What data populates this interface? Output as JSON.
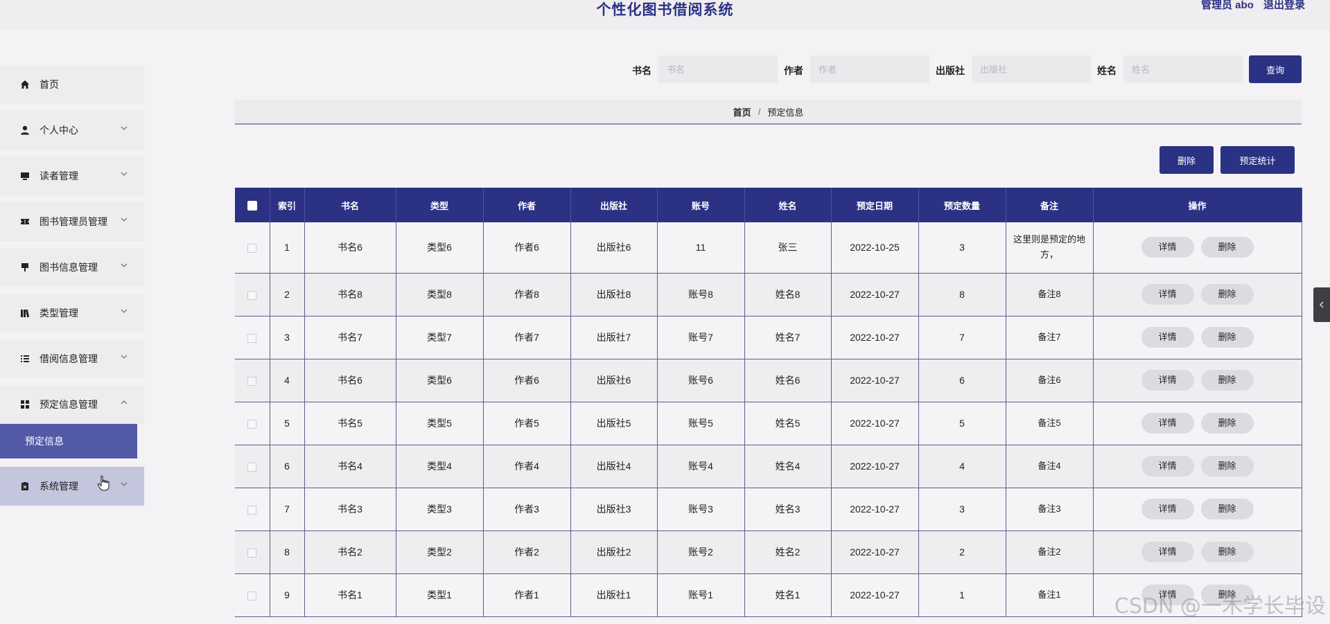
{
  "header": {
    "title": "个性化图书借阅系统",
    "user_label": "管理员 abo",
    "logout_label": "退出登录"
  },
  "sidebar": {
    "items": [
      {
        "label": "首页",
        "icon": "home-icon"
      },
      {
        "label": "个人中心",
        "icon": "user-icon"
      },
      {
        "label": "读者管理",
        "icon": "monitor-icon"
      },
      {
        "label": "图书管理员管理",
        "icon": "ticket-icon"
      },
      {
        "label": "图书信息管理",
        "icon": "pin-icon"
      },
      {
        "label": "类型管理",
        "icon": "books-icon"
      },
      {
        "label": "借阅信息管理",
        "icon": "list-icon"
      },
      {
        "label": "预定信息管理",
        "icon": "grid-icon"
      },
      {
        "label": "系统管理",
        "icon": "clipboard-icon"
      }
    ],
    "active_sub": "预定信息"
  },
  "search": {
    "book_label": "书名",
    "book_placeholder": "书名",
    "author_label": "作者",
    "author_placeholder": "作者",
    "publisher_label": "出版社",
    "publisher_placeholder": "出版社",
    "name_label": "姓名",
    "name_placeholder": "姓名",
    "query_label": "查询"
  },
  "breadcrumb": {
    "home": "首页",
    "sep": "/",
    "current": "预定信息"
  },
  "actions": {
    "delete_label": "删除",
    "stats_label": "预定统计"
  },
  "table": {
    "columns": [
      "索引",
      "书名",
      "类型",
      "作者",
      "出版社",
      "账号",
      "姓名",
      "预定日期",
      "预定数量",
      "备注",
      "操作"
    ],
    "detail_label": "详情",
    "delete_label": "删除",
    "rows": [
      {
        "index": "1",
        "book": "书名6",
        "type": "类型6",
        "author": "作者6",
        "publisher": "出版社6",
        "account": "11",
        "name": "张三",
        "date": "2022-10-25",
        "qty": "3",
        "note": "这里则是预定的地方，"
      },
      {
        "index": "2",
        "book": "书名8",
        "type": "类型8",
        "author": "作者8",
        "publisher": "出版社8",
        "account": "账号8",
        "name": "姓名8",
        "date": "2022-10-27",
        "qty": "8",
        "note": "备注8"
      },
      {
        "index": "3",
        "book": "书名7",
        "type": "类型7",
        "author": "作者7",
        "publisher": "出版社7",
        "account": "账号7",
        "name": "姓名7",
        "date": "2022-10-27",
        "qty": "7",
        "note": "备注7"
      },
      {
        "index": "4",
        "book": "书名6",
        "type": "类型6",
        "author": "作者6",
        "publisher": "出版社6",
        "account": "账号6",
        "name": "姓名6",
        "date": "2022-10-27",
        "qty": "6",
        "note": "备注6"
      },
      {
        "index": "5",
        "book": "书名5",
        "type": "类型5",
        "author": "作者5",
        "publisher": "出版社5",
        "account": "账号5",
        "name": "姓名5",
        "date": "2022-10-27",
        "qty": "5",
        "note": "备注5"
      },
      {
        "index": "6",
        "book": "书名4",
        "type": "类型4",
        "author": "作者4",
        "publisher": "出版社4",
        "account": "账号4",
        "name": "姓名4",
        "date": "2022-10-27",
        "qty": "4",
        "note": "备注4"
      },
      {
        "index": "7",
        "book": "书名3",
        "type": "类型3",
        "author": "作者3",
        "publisher": "出版社3",
        "account": "账号3",
        "name": "姓名3",
        "date": "2022-10-27",
        "qty": "3",
        "note": "备注3"
      },
      {
        "index": "8",
        "book": "书名2",
        "type": "类型2",
        "author": "作者2",
        "publisher": "出版社2",
        "account": "账号2",
        "name": "姓名2",
        "date": "2022-10-27",
        "qty": "2",
        "note": "备注2"
      },
      {
        "index": "9",
        "book": "书名1",
        "type": "类型1",
        "author": "作者1",
        "publisher": "出版社1",
        "account": "账号1",
        "name": "姓名1",
        "date": "2022-10-27",
        "qty": "1",
        "note": "备注1"
      }
    ]
  },
  "watermark": "CSDN @一木学长毕设",
  "colors": {
    "primary": "#2b3284",
    "submenu_active": "#525aa8",
    "hover": "#c3c6dc"
  }
}
